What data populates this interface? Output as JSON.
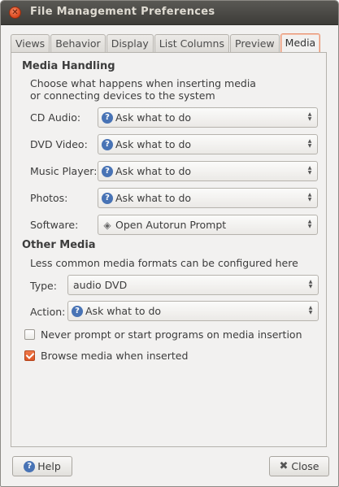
{
  "window": {
    "title": "File Management Preferences"
  },
  "tabs": [
    "Views",
    "Behavior",
    "Display",
    "List Columns",
    "Preview",
    "Media"
  ],
  "active_tab": "Media",
  "media_handling": {
    "heading": "Media Handling",
    "desc_line1": "Choose what happens when inserting media",
    "desc_line2": "or connecting devices to the system",
    "rows": [
      {
        "label": "CD Audio:",
        "value": "Ask what to do",
        "icon": "question-icon"
      },
      {
        "label": "DVD Video:",
        "value": "Ask what to do",
        "icon": "question-icon"
      },
      {
        "label": "Music Player:",
        "value": "Ask what to do",
        "icon": "question-icon"
      },
      {
        "label": "Photos:",
        "value": "Ask what to do",
        "icon": "question-icon"
      },
      {
        "label": "Software:",
        "value": "Open Autorun Prompt",
        "icon": "autorun-icon"
      }
    ]
  },
  "other_media": {
    "heading": "Other Media",
    "desc": "Less common media formats can be configured here",
    "type_label": "Type:",
    "type_value": "audio DVD",
    "action_label": "Action:",
    "action_value": "Ask what to do"
  },
  "options": {
    "never_prompt": {
      "label": "Never prompt or start programs on media insertion",
      "checked": false
    },
    "browse_media": {
      "label": "Browse media when inserted",
      "checked": true
    }
  },
  "buttons": {
    "help": "Help",
    "close": "Close"
  }
}
